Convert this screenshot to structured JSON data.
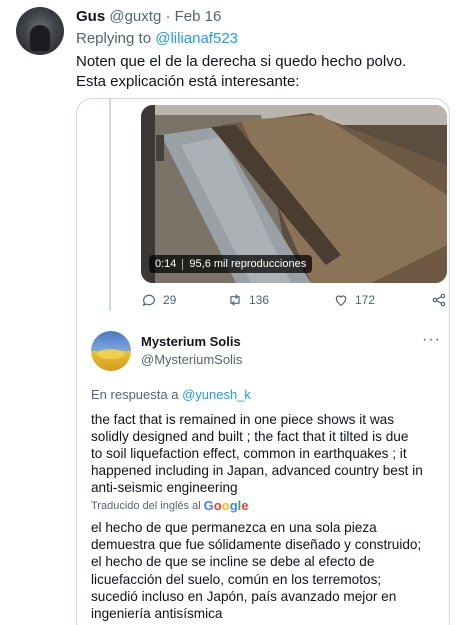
{
  "tweet": {
    "author_name": "Gus",
    "author_handle": "@guxtg",
    "separator": " · ",
    "date": "Feb 16",
    "replying_prefix": "Replying to ",
    "replying_handle": "@lilianaf523",
    "text_lines": [
      "Noten que el de la derecha si quedo hecho polvo.",
      "Esta explicación está interesante:"
    ]
  },
  "quoted": {
    "video": {
      "duration": "0:14",
      "views": "95,6 mil reproducciones"
    },
    "actions": {
      "replies": "29",
      "retweets": "136",
      "likes": "172"
    },
    "reply_tweet": {
      "author_name": "Mysterium Solis",
      "author_handle": "@MysteriumSolis",
      "more": "···",
      "in_reply_prefix": "En respuesta a ",
      "in_reply_handle": "@yunesh_k",
      "body_lines": [
        "the fact that is remained in one piece shows it was",
        "solidly designed and built ; the fact that it tilted is due",
        "to soil liquefaction effect, common in earthquakes ; it",
        "happened including in Japan, advanced country best in",
        "anti-seismic engineering"
      ],
      "translated_label": "Traducido del inglés al",
      "translator_logo": "Google",
      "translation_lines": [
        "el hecho de que permanezca en una sola pieza",
        "demuestra que fue sólidamente diseñado y construido;",
        "el hecho de que se incline se debe al efecto de",
        "licuefacción del suelo, común en los terremotos;",
        "sucedió incluso en Japón, país avanzado mejor en",
        "ingeniería antisísmica"
      ]
    }
  },
  "icons": {
    "reply": "reply-icon",
    "retweet": "retweet-icon",
    "like": "heart-icon",
    "share": "share-icon",
    "more": "more-dots-icon"
  },
  "colors": {
    "link": "#1d9bf0",
    "secondary_text": "#536471",
    "border": "#cfd9de"
  }
}
